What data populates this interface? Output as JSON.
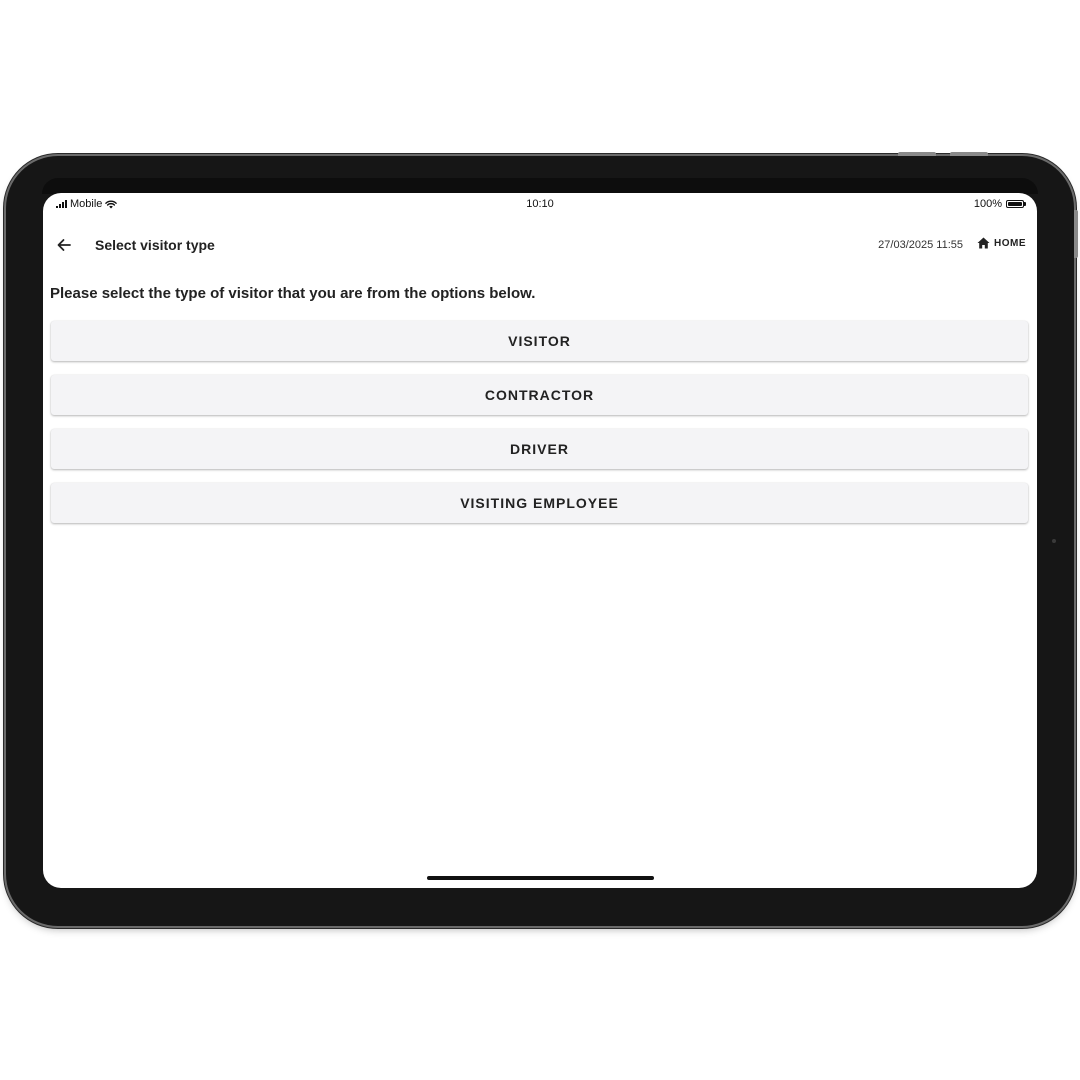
{
  "status_bar": {
    "carrier": "Mobile",
    "time": "10:10",
    "battery": "100%"
  },
  "header": {
    "title": "Select visitor type",
    "datetime": "27/03/2025 11:55",
    "home_label": "HOME"
  },
  "instructions": "Please select the type of visitor that you are from the options below.",
  "options": [
    {
      "label": "VISITOR"
    },
    {
      "label": "CONTRACTOR"
    },
    {
      "label": "DRIVER"
    },
    {
      "label": "VISITING EMPLOYEE"
    }
  ],
  "icons": {
    "back": "arrow-left-icon",
    "home": "home-icon",
    "signal": "cellular-signal-icon",
    "wifi": "wifi-icon",
    "battery": "battery-icon"
  },
  "colors": {
    "button_background": "#f4f4f6",
    "text": "#222222",
    "device_frame": "#161616"
  },
  "battery_level": 1.0
}
